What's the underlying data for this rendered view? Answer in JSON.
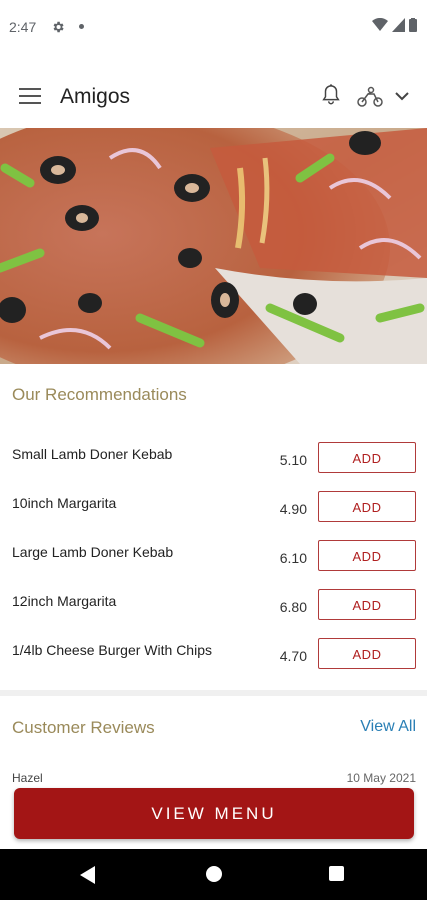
{
  "status": {
    "time": "2:47"
  },
  "app_bar": {
    "title": "Amigos"
  },
  "recommendations": {
    "title": "Our Recommendations",
    "add_label": "ADD",
    "items": [
      {
        "name": "Small Lamb Doner Kebab",
        "price": "5.10"
      },
      {
        "name": "10inch Margarita",
        "price": "4.90"
      },
      {
        "name": "Large Lamb Doner Kebab",
        "price": "6.10"
      },
      {
        "name": "12inch Margarita",
        "price": "6.80"
      },
      {
        "name": "1/4lb  Cheese Burger With Chips",
        "price": "4.70"
      }
    ]
  },
  "reviews": {
    "title": "Customer Reviews",
    "view_all": "View All",
    "first": {
      "name": "Hazel",
      "date": "10 May 2021"
    }
  },
  "cta": {
    "label": "VIEW MENU"
  },
  "colors": {
    "accent": "#a31515",
    "section_title": "#9a8a5a",
    "link": "#2a7fb5"
  }
}
